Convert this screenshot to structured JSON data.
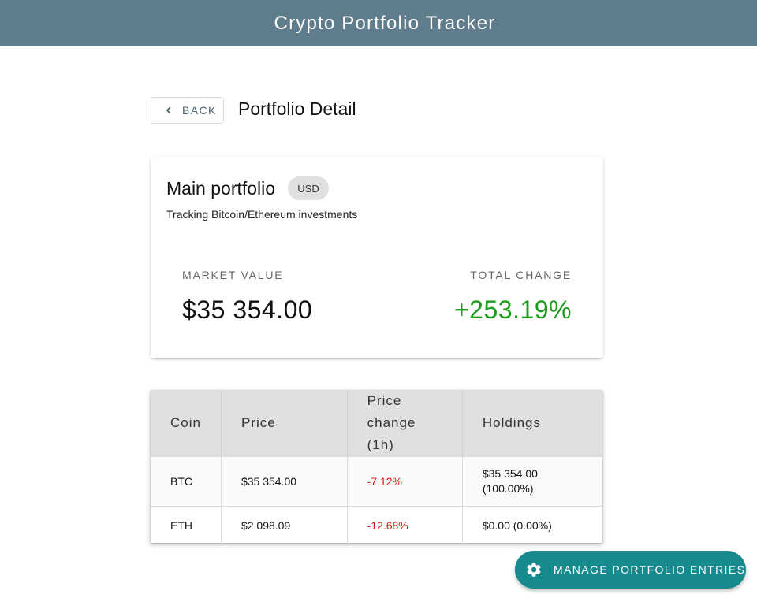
{
  "app": {
    "title": "Crypto Portfolio Tracker"
  },
  "header": {
    "back_label": "BACK",
    "back_icon": "chevron-left-icon",
    "page_title": "Portfolio Detail"
  },
  "portfolio": {
    "name": "Main portfolio",
    "currency": "USD",
    "description": "Tracking Bitcoin/Ethereum investments",
    "market_value_label": "MARKET VALUE",
    "market_value": "$35 354.00",
    "total_change_label": "TOTAL CHANGE",
    "total_change": "+253.19%"
  },
  "table": {
    "headers": [
      "Coin",
      "Price",
      "Price change (1h)",
      "Holdings"
    ],
    "rows": [
      {
        "coin": "BTC",
        "price": "$35 354.00",
        "change": "-7.12%",
        "holdings": "$35 354.00 (100.00%)"
      },
      {
        "coin": "ETH",
        "price": "$2 098.09",
        "change": "-12.68%",
        "holdings": "$0.00 (0.00%)"
      }
    ]
  },
  "fab": {
    "label": "MANAGE PORTFOLIO ENTRIES",
    "icon": "gear-icon"
  },
  "colors": {
    "appbar": "#5f7d8c",
    "positive": "#1e9a1e",
    "negative": "#d81b1b",
    "fab": "#168a8d"
  }
}
